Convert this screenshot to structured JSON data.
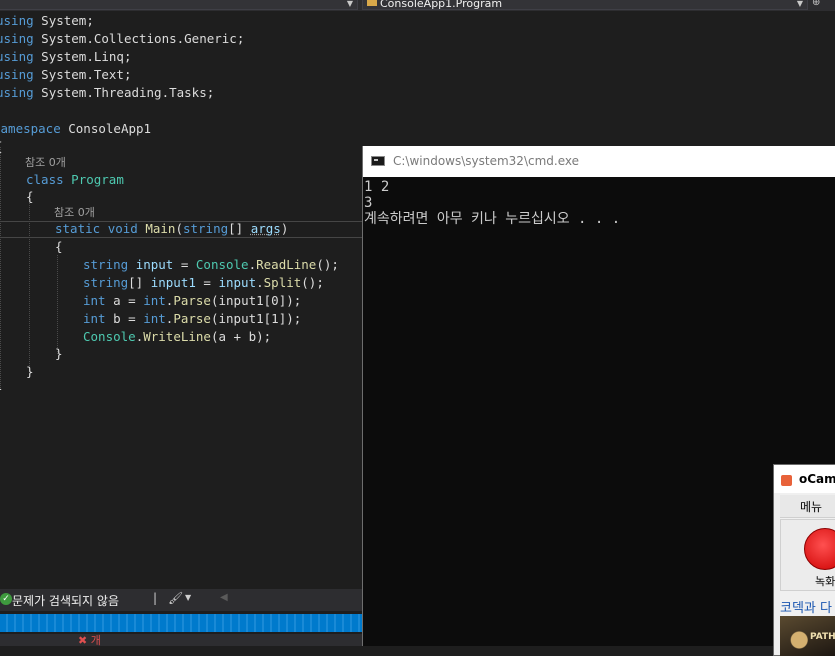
{
  "editor": {
    "nav_left": "",
    "nav_right": "ConsoleApp1.Program",
    "lines": {
      "u1_kw": "using",
      "u1_rest": " System;",
      "u2_kw": "using",
      "u2_rest": " System.Collections.Generic;",
      "u3_kw": "using",
      "u3_rest": " System.Linq;",
      "u4_kw": "using",
      "u4_rest": " System.Text;",
      "u5_kw": "using",
      "u5_rest": " System.Threading.Tasks;",
      "ns_kw": "namespace",
      "ns_name": " ConsoleApp1",
      "open_brace": "{",
      "lens1": "참조 0개",
      "class_kw": "class",
      "class_name": "Program",
      "class_open": "{",
      "lens2": "참조 0개",
      "m_static": "static",
      "m_void": "void",
      "m_name": "Main",
      "m_paren_open": "(",
      "m_string": "string",
      "m_arr": "[] ",
      "m_args": "args",
      "m_paren_close": ")",
      "body_open": "{",
      "l1_type": "string",
      "l1_var": "input",
      "l1_eq": " = ",
      "l1_cls": "Console",
      "l1_dot": ".",
      "l1_fn": "ReadLine",
      "l1_end": "();",
      "l2_type": "string",
      "l2_arr": "[] ",
      "l2_var": "input1",
      "l2_eq": " = ",
      "l2_obj": "input",
      "l2_dot": ".",
      "l2_fn": "Split",
      "l2_end": "();",
      "l3_type": "int",
      "l3_var": " a = ",
      "l3_cls": "int",
      "l3_dot": ".",
      "l3_fn": "Parse",
      "l3_end": "(input1[0]);",
      "l4_type": "int",
      "l4_var": " b = ",
      "l4_cls": "int",
      "l4_dot": ".",
      "l4_fn": "Parse",
      "l4_end": "(input1[1]);",
      "l5_cls": "Console",
      "l5_dot": ".",
      "l5_fn": "WriteLine",
      "l5_end": "(a + b);",
      "body_close": "}",
      "class_close": "}",
      "ns_close": "}"
    },
    "status_message": "문제가 검색되지 않음",
    "error_count": "개"
  },
  "cmd": {
    "title": "C:\\windows\\system32\\cmd.exe",
    "output": "1 2\n3\n계속하려면 아무 키나 누르십시오 . . ."
  },
  "ocam": {
    "title": "oCam",
    "menu": "메뉴",
    "record_label": "녹화",
    "link_text": "코덱과 다",
    "ad_text": "PATH"
  },
  "colors": {
    "editor_bg": "#1e1e1e",
    "keyword": "#569cd6",
    "type": "#4ec9b0",
    "method": "#dcdcaa",
    "parameter": "#9cdcfe",
    "text": "#dcdcdc",
    "progress": "#007acc"
  }
}
